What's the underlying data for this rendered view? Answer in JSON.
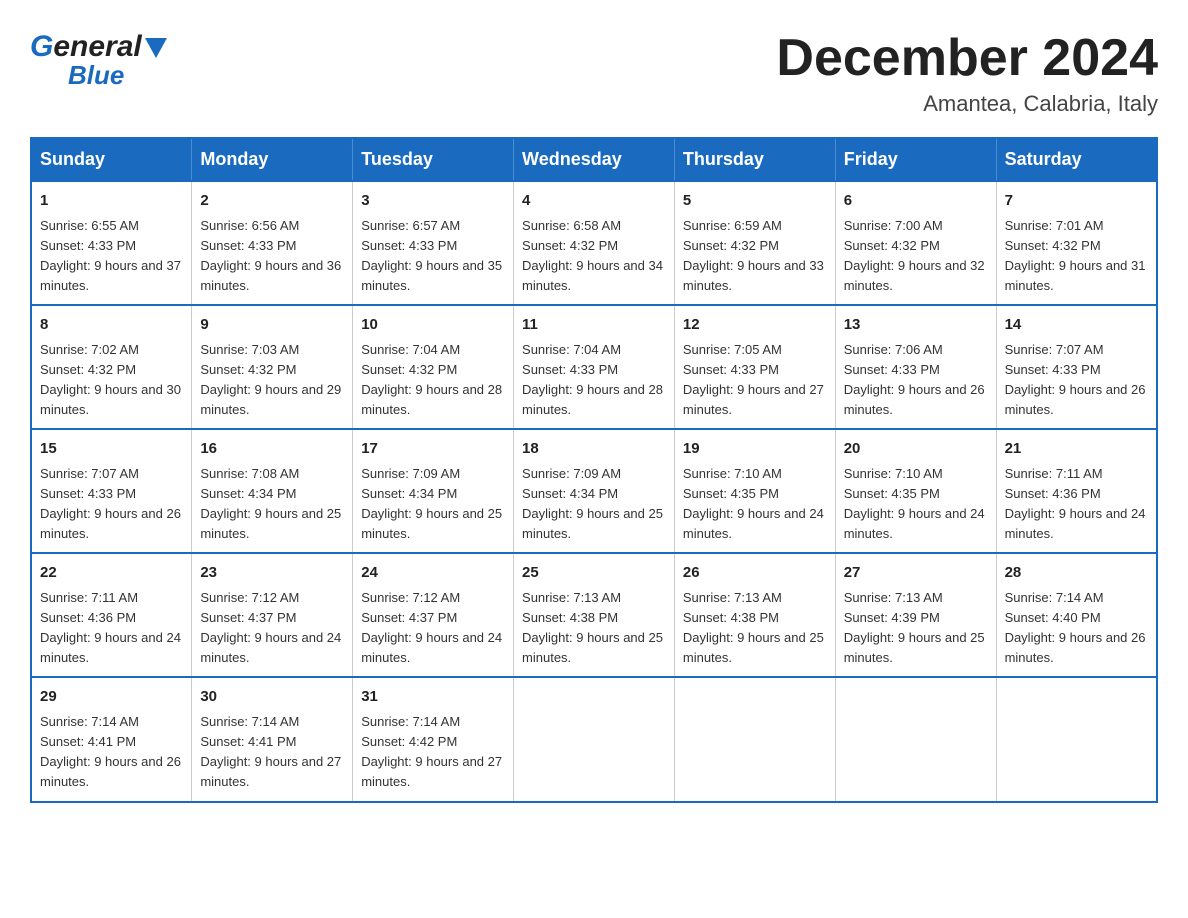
{
  "header": {
    "logo_general": "General",
    "logo_blue": "Blue",
    "month_title": "December 2024",
    "location": "Amantea, Calabria, Italy"
  },
  "days_of_week": [
    "Sunday",
    "Monday",
    "Tuesday",
    "Wednesday",
    "Thursday",
    "Friday",
    "Saturday"
  ],
  "weeks": [
    [
      {
        "day": "1",
        "sunrise": "6:55 AM",
        "sunset": "4:33 PM",
        "daylight": "9 hours and 37 minutes."
      },
      {
        "day": "2",
        "sunrise": "6:56 AM",
        "sunset": "4:33 PM",
        "daylight": "9 hours and 36 minutes."
      },
      {
        "day": "3",
        "sunrise": "6:57 AM",
        "sunset": "4:33 PM",
        "daylight": "9 hours and 35 minutes."
      },
      {
        "day": "4",
        "sunrise": "6:58 AM",
        "sunset": "4:32 PM",
        "daylight": "9 hours and 34 minutes."
      },
      {
        "day": "5",
        "sunrise": "6:59 AM",
        "sunset": "4:32 PM",
        "daylight": "9 hours and 33 minutes."
      },
      {
        "day": "6",
        "sunrise": "7:00 AM",
        "sunset": "4:32 PM",
        "daylight": "9 hours and 32 minutes."
      },
      {
        "day": "7",
        "sunrise": "7:01 AM",
        "sunset": "4:32 PM",
        "daylight": "9 hours and 31 minutes."
      }
    ],
    [
      {
        "day": "8",
        "sunrise": "7:02 AM",
        "sunset": "4:32 PM",
        "daylight": "9 hours and 30 minutes."
      },
      {
        "day": "9",
        "sunrise": "7:03 AM",
        "sunset": "4:32 PM",
        "daylight": "9 hours and 29 minutes."
      },
      {
        "day": "10",
        "sunrise": "7:04 AM",
        "sunset": "4:32 PM",
        "daylight": "9 hours and 28 minutes."
      },
      {
        "day": "11",
        "sunrise": "7:04 AM",
        "sunset": "4:33 PM",
        "daylight": "9 hours and 28 minutes."
      },
      {
        "day": "12",
        "sunrise": "7:05 AM",
        "sunset": "4:33 PM",
        "daylight": "9 hours and 27 minutes."
      },
      {
        "day": "13",
        "sunrise": "7:06 AM",
        "sunset": "4:33 PM",
        "daylight": "9 hours and 26 minutes."
      },
      {
        "day": "14",
        "sunrise": "7:07 AM",
        "sunset": "4:33 PM",
        "daylight": "9 hours and 26 minutes."
      }
    ],
    [
      {
        "day": "15",
        "sunrise": "7:07 AM",
        "sunset": "4:33 PM",
        "daylight": "9 hours and 26 minutes."
      },
      {
        "day": "16",
        "sunrise": "7:08 AM",
        "sunset": "4:34 PM",
        "daylight": "9 hours and 25 minutes."
      },
      {
        "day": "17",
        "sunrise": "7:09 AM",
        "sunset": "4:34 PM",
        "daylight": "9 hours and 25 minutes."
      },
      {
        "day": "18",
        "sunrise": "7:09 AM",
        "sunset": "4:34 PM",
        "daylight": "9 hours and 25 minutes."
      },
      {
        "day": "19",
        "sunrise": "7:10 AM",
        "sunset": "4:35 PM",
        "daylight": "9 hours and 24 minutes."
      },
      {
        "day": "20",
        "sunrise": "7:10 AM",
        "sunset": "4:35 PM",
        "daylight": "9 hours and 24 minutes."
      },
      {
        "day": "21",
        "sunrise": "7:11 AM",
        "sunset": "4:36 PM",
        "daylight": "9 hours and 24 minutes."
      }
    ],
    [
      {
        "day": "22",
        "sunrise": "7:11 AM",
        "sunset": "4:36 PM",
        "daylight": "9 hours and 24 minutes."
      },
      {
        "day": "23",
        "sunrise": "7:12 AM",
        "sunset": "4:37 PM",
        "daylight": "9 hours and 24 minutes."
      },
      {
        "day": "24",
        "sunrise": "7:12 AM",
        "sunset": "4:37 PM",
        "daylight": "9 hours and 24 minutes."
      },
      {
        "day": "25",
        "sunrise": "7:13 AM",
        "sunset": "4:38 PM",
        "daylight": "9 hours and 25 minutes."
      },
      {
        "day": "26",
        "sunrise": "7:13 AM",
        "sunset": "4:38 PM",
        "daylight": "9 hours and 25 minutes."
      },
      {
        "day": "27",
        "sunrise": "7:13 AM",
        "sunset": "4:39 PM",
        "daylight": "9 hours and 25 minutes."
      },
      {
        "day": "28",
        "sunrise": "7:14 AM",
        "sunset": "4:40 PM",
        "daylight": "9 hours and 26 minutes."
      }
    ],
    [
      {
        "day": "29",
        "sunrise": "7:14 AM",
        "sunset": "4:41 PM",
        "daylight": "9 hours and 26 minutes."
      },
      {
        "day": "30",
        "sunrise": "7:14 AM",
        "sunset": "4:41 PM",
        "daylight": "9 hours and 27 minutes."
      },
      {
        "day": "31",
        "sunrise": "7:14 AM",
        "sunset": "4:42 PM",
        "daylight": "9 hours and 27 minutes."
      },
      null,
      null,
      null,
      null
    ]
  ],
  "labels": {
    "sunrise_prefix": "Sunrise: ",
    "sunset_prefix": "Sunset: ",
    "daylight_prefix": "Daylight: "
  }
}
